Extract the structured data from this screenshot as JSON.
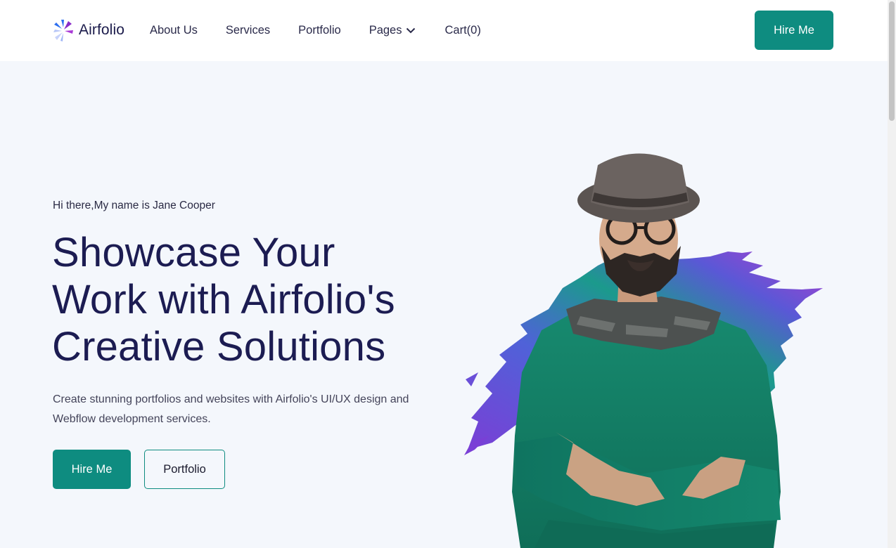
{
  "header": {
    "logo_text": "Airfolio",
    "nav": {
      "about": "About Us",
      "services": "Services",
      "portfolio": "Portfolio",
      "pages": "Pages",
      "cart": "Cart(0)"
    },
    "hire_button": "Hire Me"
  },
  "hero": {
    "greeting": "Hi there,My name is Jane Cooper",
    "headline_line1": "Showcase Your",
    "headline_line2": "Work with Airfolio's",
    "headline_line3": "Creative Solutions",
    "description": "Create stunning portfolios and websites with Airfolio's UI/UX design and Webflow development services.",
    "primary_button": "Hire Me",
    "secondary_button": "Portfolio",
    "image_icon": "person-portrait-image"
  },
  "colors": {
    "accent": "#0e8c80",
    "heading": "#1c1c52",
    "background": "#f4f7fc",
    "brush_start": "#1b9a8c",
    "brush_mid": "#6a4fd8",
    "brush_end": "#a23fd0"
  }
}
